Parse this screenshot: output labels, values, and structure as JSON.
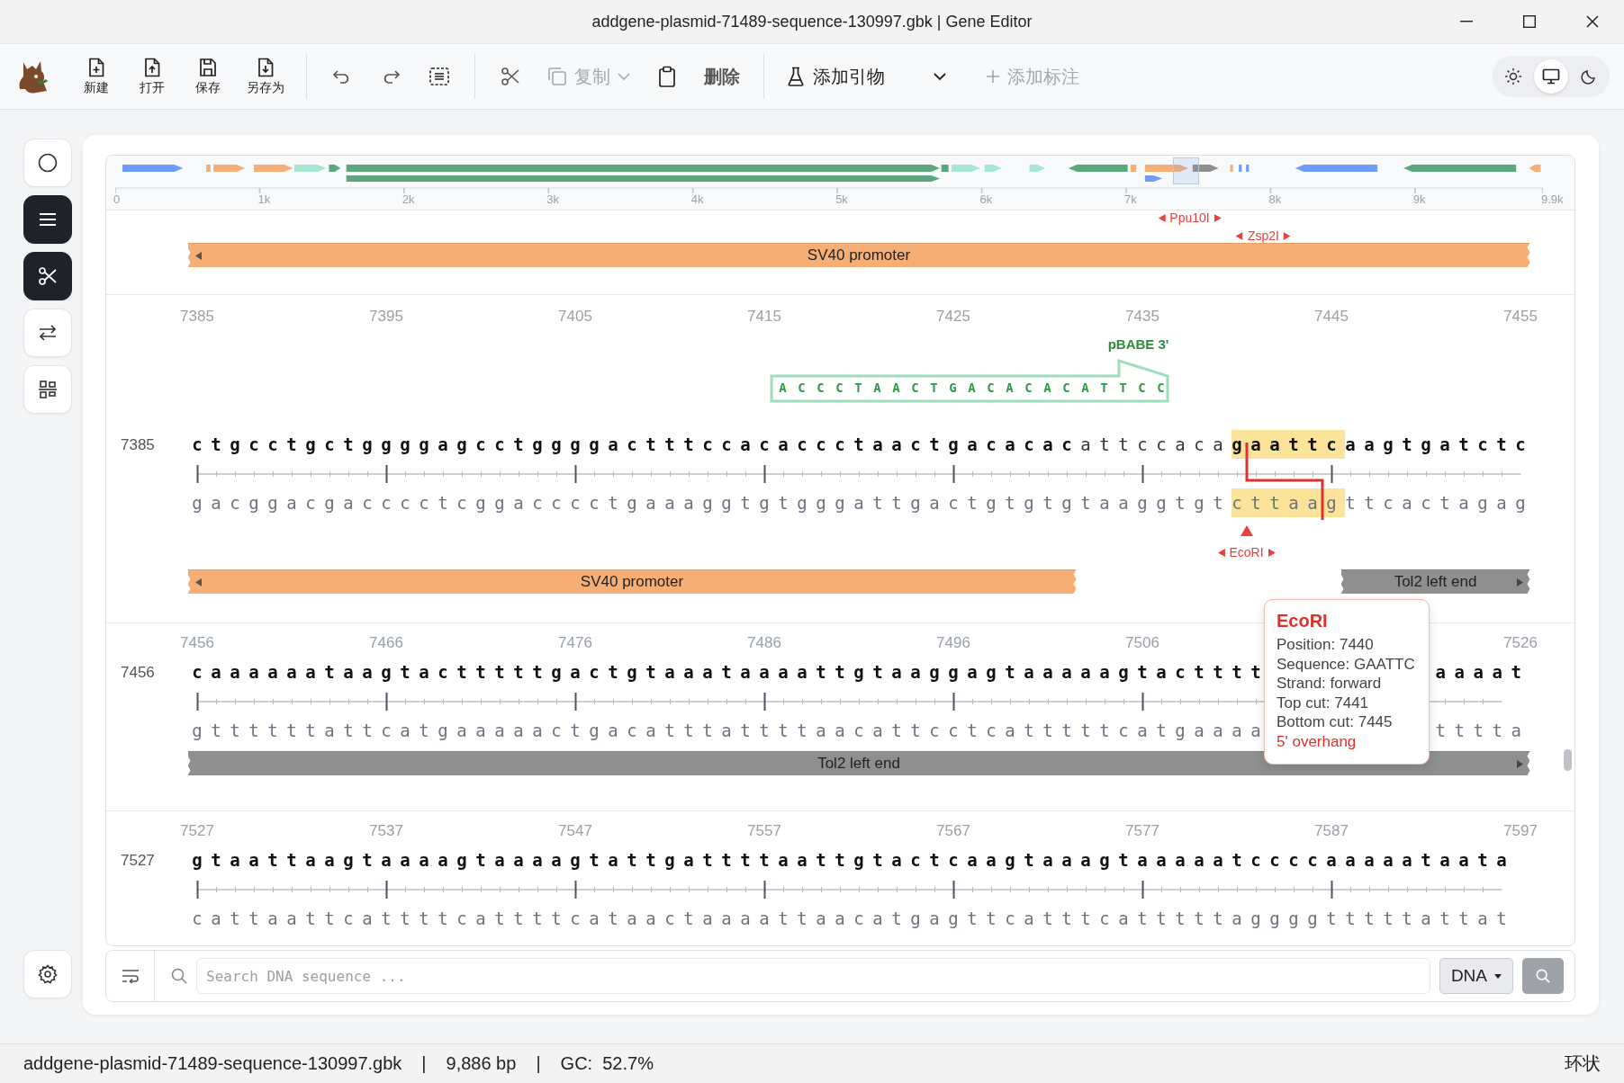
{
  "window": {
    "title": "addgene-plasmid-71489-sequence-130997.gbk | Gene Editor"
  },
  "toolbar": {
    "file_buttons": [
      {
        "kind": "new",
        "label": "新建"
      },
      {
        "kind": "open",
        "label": "打开"
      },
      {
        "kind": "save",
        "label": "保存"
      },
      {
        "kind": "saveas",
        "label": "另存为"
      }
    ],
    "copy_button": {
      "label": "复制",
      "disabled": true
    },
    "delete_button": {
      "label": "删除",
      "disabled": false
    },
    "primer_button": {
      "label": "添加引物"
    },
    "annotate_button": {
      "label": "添加标注",
      "disabled": true
    },
    "theme": [
      {
        "kind": "light",
        "selected": false
      },
      {
        "kind": "system",
        "selected": true
      },
      {
        "kind": "dark",
        "selected": false
      }
    ]
  },
  "sidebar": {
    "items": [
      {
        "kind": "circle",
        "selected": false
      },
      {
        "kind": "list",
        "selected": true
      },
      {
        "kind": "scissors",
        "selected": true
      },
      {
        "kind": "swap",
        "selected": false
      },
      {
        "kind": "align",
        "selected": false
      }
    ]
  },
  "map": {
    "axis_labels": [
      "0",
      "1k",
      "2k",
      "3k",
      "4k",
      "5k",
      "6k",
      "7k",
      "8k",
      "9k",
      "9.9k"
    ]
  },
  "rows": [
    {
      "enzymes": [
        {
          "name": "Ppu10I"
        },
        {
          "name": "Zsp2I"
        }
      ],
      "features": [
        {
          "name": "SV40 promoter",
          "color": "#f7ae74",
          "reverse": true
        }
      ]
    },
    {
      "number": "7385",
      "ruler": [
        "7385",
        "7395",
        "7405",
        "7415",
        "7425",
        "7435",
        "7445",
        "7455"
      ],
      "primer": {
        "label": "pBABE 3'",
        "sequence": "ACCCTAACTGACACACATTCC"
      },
      "top": [
        [
          {
            "text": "ctgcctgctggggagcctggggactttccacaccctaactgacacac",
            "kind": "bold"
          },
          {
            "text": "attccaca",
            "kind": "plain"
          },
          {
            "text": "gaattc",
            "kind": "site"
          },
          {
            "text": "aagtgatctc",
            "kind": "bold"
          }
        ]
      ],
      "bottom": [
        [
          {
            "text": "gacggacgacccctcggacccctgaaaggtgtgggattgactgtgtgtaaggtgt",
            "kind": "plain"
          },
          {
            "text": "cttaag",
            "kind": "site"
          },
          {
            "text": "ttcactagag",
            "kind": "plain"
          }
        ]
      ],
      "cut": {
        "name": "EcoRI"
      },
      "features": [
        {
          "name": "SV40 promoter",
          "color": "#f7ae74",
          "reverse": true
        },
        {
          "name": "Tol2 left end",
          "color": "#8f8f8f",
          "reverse": false
        }
      ]
    },
    {
      "number": "7456",
      "ruler": [
        "7456",
        "7466",
        "7476",
        "7486",
        "7496",
        "7506",
        "7526"
      ],
      "top": [
        [
          {
            "text": "caaaaaataagtactttttgactgtaaataaaattgtaaggagtaaaaagtactttt",
            "kind": "bold"
          }
        ],
        [
          {
            "text": "aaaat",
            "kind": "bold"
          }
        ]
      ],
      "bottom": [
        [
          {
            "text": "gttttttattcatgaaaaactgacatttattttaacattcctcatttttcatgaaaa",
            "kind": "plain"
          }
        ],
        [
          {
            "text": "tttta",
            "kind": "plain"
          }
        ]
      ],
      "features": [
        {
          "name": "Tol2 left end",
          "color": "#8f8f8f",
          "reverse": false
        }
      ]
    },
    {
      "number": "7527",
      "ruler": [
        "7527",
        "7537",
        "7547",
        "7557",
        "7567",
        "7577",
        "7587",
        "7597"
      ],
      "top": [
        [
          {
            "text": "gtaattaagtaaaagtaaaagtattgattttaattgtactcaagtaaagtaaaaatccccaaaaataata",
            "kind": "bold"
          }
        ]
      ],
      "bottom": [
        [
          {
            "text": "cattaattcattttcattttcataactaaaattaacatgagttcatttcatttttaggggtttttattat",
            "kind": "plain"
          }
        ]
      ]
    }
  ],
  "tooltip": {
    "title": "EcoRI",
    "lines": [
      "Position: 7440",
      "Sequence: GAATTC",
      "Strand: forward",
      "Top cut: 7441",
      "Bottom cut: 7445"
    ],
    "note": "5' overhang"
  },
  "search": {
    "placeholder": "Search DNA sequence ...",
    "mode": "DNA"
  },
  "status_bar": {
    "items": [
      "addgene-plasmid-71489-sequence-130997.gbk",
      "9,886 bp",
      "GC:  52.7%"
    ],
    "separator": "|",
    "topology": "环状"
  }
}
